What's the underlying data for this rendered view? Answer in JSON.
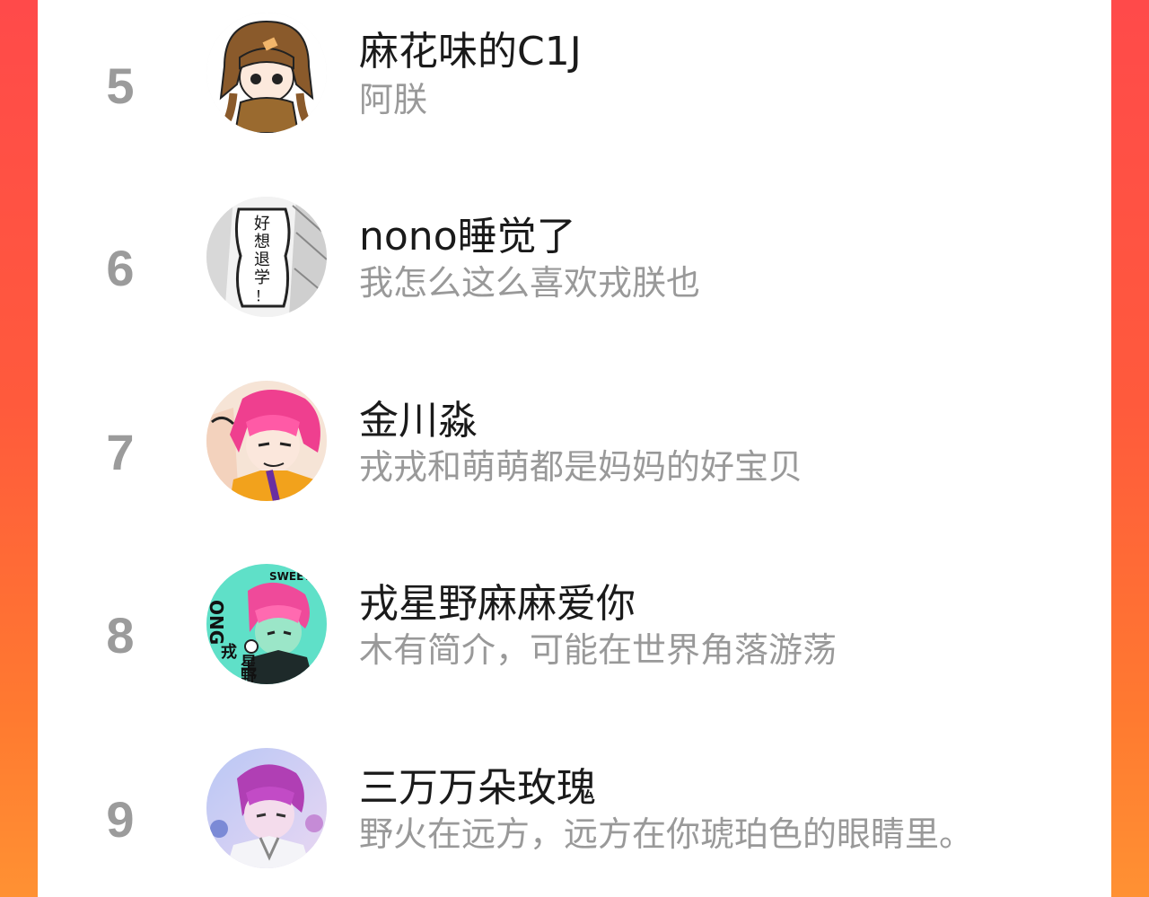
{
  "colors": {
    "background_gradient_top": "#ff4a4a",
    "background_gradient_bottom": "#ff9133",
    "panel": "#ffffff",
    "rank_text": "#9b9b9b",
    "name_text": "#1a1a1a",
    "bio_text": "#999999"
  },
  "ranking": [
    {
      "rank": "5",
      "name": "麻花味的C1J",
      "bio": "阿朕",
      "avatar_icon": "chibi-girl-avatar"
    },
    {
      "rank": "6",
      "name": "nono睡觉了",
      "bio": "我怎么这么喜欢戎朕也",
      "avatar_icon": "manga-text-avatar",
      "avatar_text": [
        "好",
        "想",
        "退",
        "学",
        "！"
      ]
    },
    {
      "rank": "7",
      "name": "金川淼",
      "bio": "戎戎和萌萌都是妈妈的好宝贝",
      "avatar_icon": "pink-hair-character-avatar"
    },
    {
      "rank": "8",
      "name": "戎星野麻麻爱你",
      "bio": "木有简介，可能在世界角落游荡",
      "avatar_icon": "pink-hair-poster-avatar",
      "avatar_text": [
        "SWEETY",
        "ONG",
        "星",
        "野",
        "戎"
      ]
    },
    {
      "rank": "9",
      "name": "三万万朵玫瑰",
      "bio": "野火在远方，远方在你琥珀色的眼睛里。",
      "avatar_icon": "purple-hair-character-avatar"
    }
  ]
}
